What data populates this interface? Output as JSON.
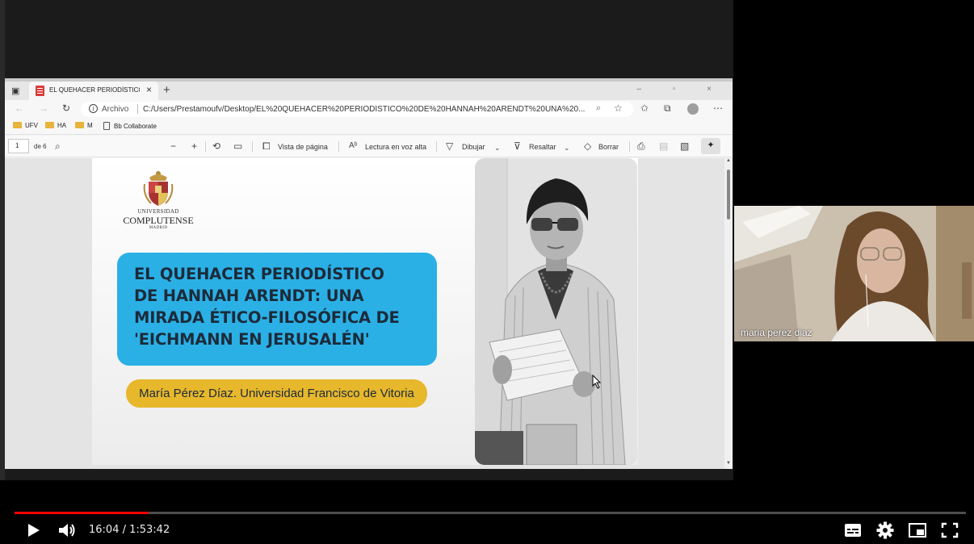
{
  "browser": {
    "tab_title": "EL QUEHACER PERIODÍSTICO DE",
    "tab_close": "×",
    "new_tab": "+",
    "window_controls": "– ▫ ×",
    "archivo_label": "Archivo",
    "url": "C:/Users/Prestamoufv/Desktop/EL%20QUEHACER%20PERIODÍSTICO%20DE%20HANNAH%20ARENDT%20UNA%20...",
    "favorites": [
      "UFV",
      "HA",
      "M",
      "Bb Collaborate"
    ]
  },
  "pdf_toolbar": {
    "page_number": "1",
    "page_of": "de 6",
    "zoom_out": "−",
    "zoom_in": "+",
    "page_view": "Vista de página",
    "read_aloud": "Lectura en voz alta",
    "draw": "Dibujar",
    "highlight": "Resaltar",
    "erase": "Borrar"
  },
  "slide": {
    "university_line1": "UNIVERSIDAD",
    "university_line2": "COMPLUTENSE",
    "university_line3": "MADRID",
    "title": "EL QUEHACER PERIODÍSTICO\nDE HANNAH ARENDT: UNA\nMIRADA ÉTICO-FILOSÓFICA DE\n'EICHMANN EN JERUSALÉN'",
    "author": "María Pérez Díaz. Universidad Francisco de Vitoria",
    "colors": {
      "title_box": "#2bb0e6",
      "author_box": "#e7b72c",
      "text": "#1c2b3a"
    }
  },
  "webcam": {
    "participant_name": "maria perez diaz"
  },
  "player": {
    "time": "16:04 / 1:53:42",
    "progress": 0.1413,
    "buffered": 0.1413,
    "accent_color": "#ff0000"
  }
}
